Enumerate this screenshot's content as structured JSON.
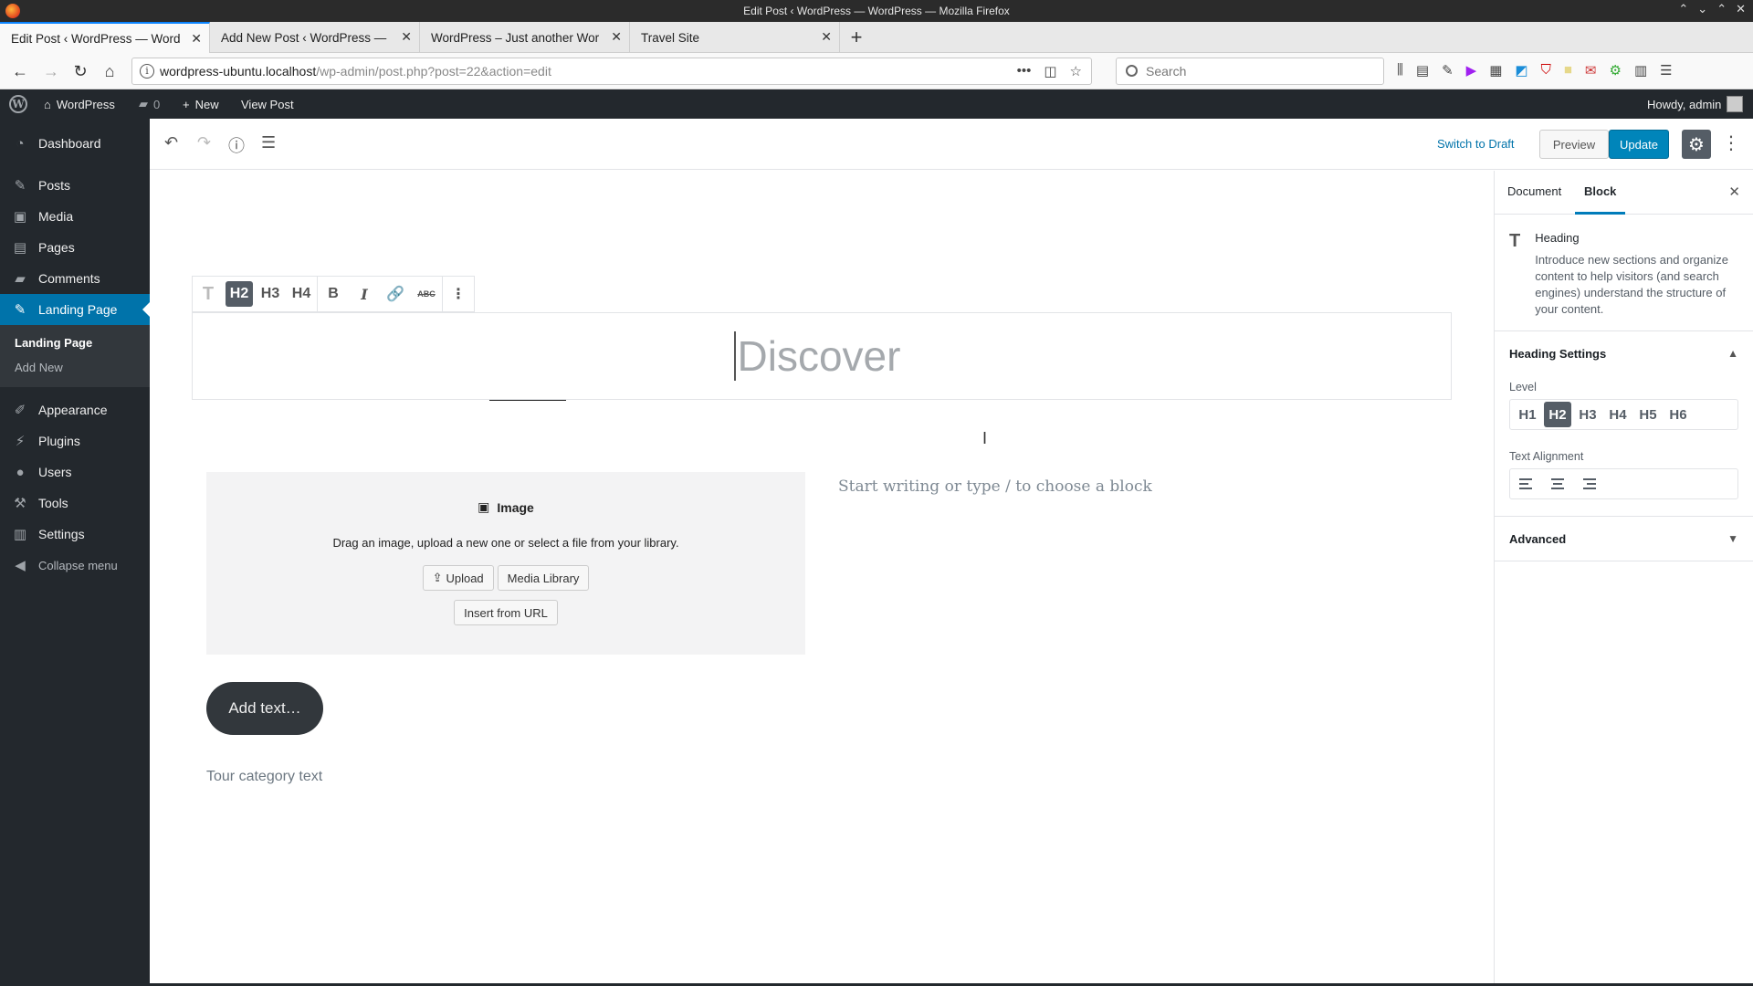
{
  "browser": {
    "window_title": "Edit Post ‹ WordPress — WordPress — Mozilla Firefox",
    "tabs": [
      {
        "label": "Edit Post ‹ WordPress — Word"
      },
      {
        "label": "Add New Post ‹ WordPress —"
      },
      {
        "label": "WordPress – Just another Wor"
      },
      {
        "label": "Travel Site"
      }
    ],
    "url_host": "wordpress-ubuntu.localhost",
    "url_path": "/wp-admin/post.php?post=22&action=edit",
    "search_placeholder": "Search"
  },
  "adminbar": {
    "site": "WordPress",
    "comments": "0",
    "new": "New",
    "view_post": "View Post",
    "howdy": "Howdy, admin"
  },
  "sidebar": {
    "items": [
      {
        "label": "Dashboard",
        "icon": "dashboard-icon"
      },
      {
        "label": "Posts",
        "icon": "pin-icon"
      },
      {
        "label": "Media",
        "icon": "media-icon"
      },
      {
        "label": "Pages",
        "icon": "page-icon"
      },
      {
        "label": "Comments",
        "icon": "comment-icon"
      },
      {
        "label": "Landing Page",
        "icon": "pin-icon"
      },
      {
        "label": "Appearance",
        "icon": "brush-icon"
      },
      {
        "label": "Plugins",
        "icon": "plug-icon"
      },
      {
        "label": "Users",
        "icon": "user-icon"
      },
      {
        "label": "Tools",
        "icon": "wrench-icon"
      },
      {
        "label": "Settings",
        "icon": "settings-icon"
      }
    ],
    "submenu": [
      "Landing Page",
      "Add New"
    ],
    "collapse": "Collapse menu"
  },
  "editor": {
    "switch_to_draft": "Switch to Draft",
    "preview": "Preview",
    "update": "Update",
    "heading_text": "Discover",
    "toolbar": {
      "h2": "H2",
      "h3": "H3",
      "h4": "H4",
      "bold": "B",
      "italic": "I",
      "strike": "ABC"
    },
    "image_block": {
      "title": "Image",
      "description": "Drag an image, upload a new one or select a file from your library.",
      "upload": "Upload",
      "media_library": "Media Library",
      "insert_url": "Insert from URL"
    },
    "start_writing": "Start writing or type / to choose a block",
    "add_text": "Add text…",
    "tour_category": "Tour category text"
  },
  "settings_panel": {
    "tab_document": "Document",
    "tab_block": "Block",
    "block_name": "Heading",
    "block_desc": "Introduce new sections and organize content to help visitors (and search engines) understand the structure of your content.",
    "heading_settings": "Heading Settings",
    "level_label": "Level",
    "levels": [
      "H1",
      "H2",
      "H3",
      "H4",
      "H5",
      "H6"
    ],
    "selected_level": "H2",
    "alignment_label": "Text Alignment",
    "advanced": "Advanced"
  },
  "colors": {
    "accent": "#0073aa",
    "update": "#0085ba",
    "admin_bg": "#23282d"
  }
}
